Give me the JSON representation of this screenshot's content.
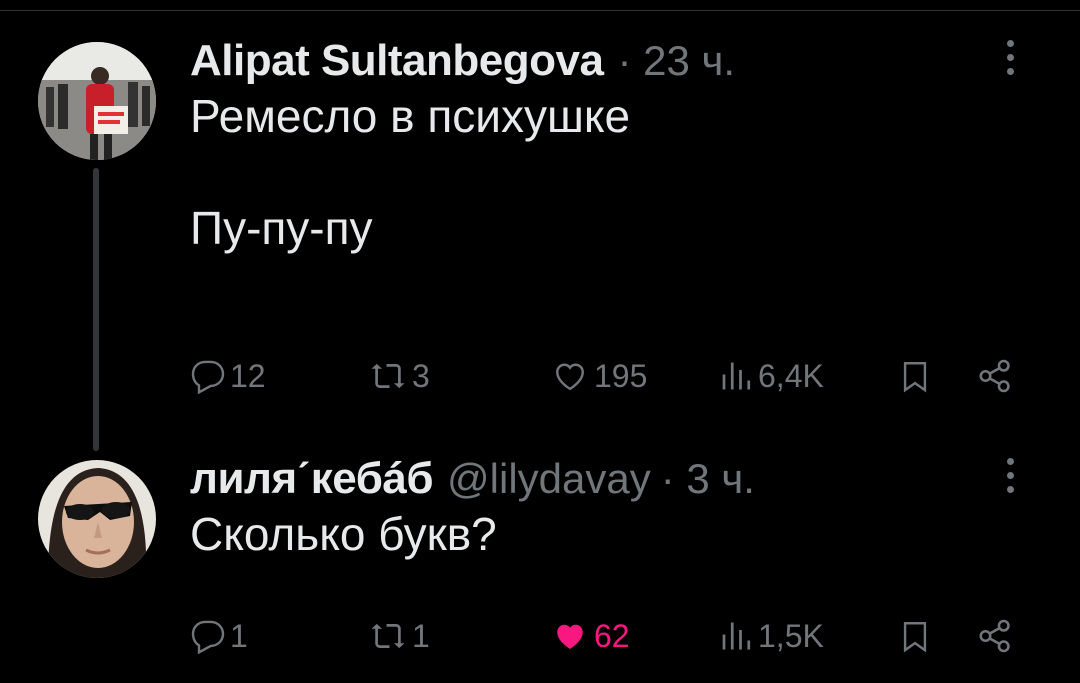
{
  "tweets": [
    {
      "author_name": "Alipat Sultanbegova",
      "handle": "",
      "time": "· 23 ч.",
      "text": "Ремесло в психушке\n\nПу-пу-пу",
      "stats": {
        "replies": "12",
        "retweets": "3",
        "likes": "195",
        "views": "6,4K"
      },
      "liked": false
    },
    {
      "author_name": "лиляˊкебáб",
      "handle": "@lilydavay",
      "time": "· 3 ч.",
      "text": "Сколько букв?",
      "stats": {
        "replies": "1",
        "retweets": "1",
        "likes": "62",
        "views": "1,5K"
      },
      "liked": true
    }
  ],
  "icons": {
    "reply": "reply-icon",
    "retweet": "retweet-icon",
    "like": "heart-icon",
    "views": "views-icon",
    "bookmark": "bookmark-icon",
    "share": "share-icon",
    "more": "more-dots-icon"
  },
  "colors": {
    "background": "#000000",
    "text": "#e7e9ea",
    "muted": "#71767b",
    "like_active": "#f91880",
    "thread_line": "#333639"
  }
}
